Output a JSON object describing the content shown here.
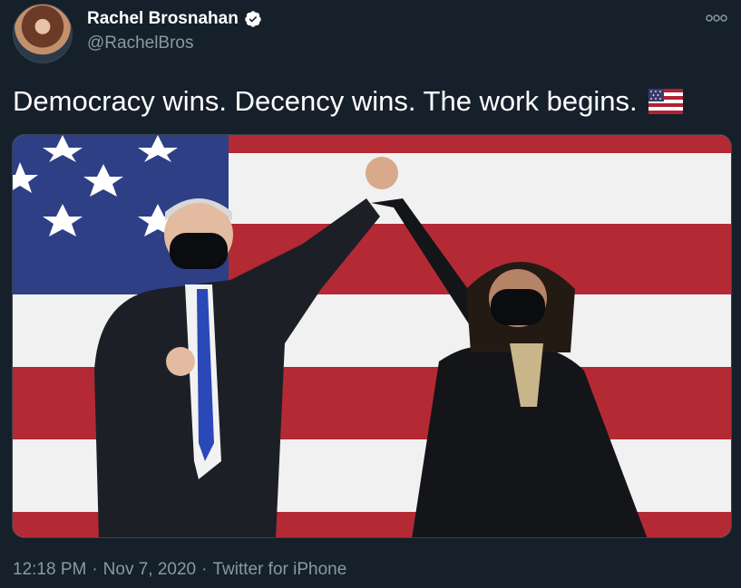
{
  "tweet": {
    "author": {
      "display_name": "Rachel Brosnahan",
      "handle": "@RachelBros",
      "verified": true,
      "avatar_icon": "profile-photo"
    },
    "text": "Democracy wins. Decency wins. The work begins.",
    "emoji": "us-flag-icon",
    "media": {
      "kind": "photo",
      "alt": ""
    },
    "time": "12:18 PM",
    "separator": "·",
    "date": "Nov 7, 2020",
    "source": "Twitter for iPhone"
  },
  "colors": {
    "background": "#15202b",
    "text": "#ffffff",
    "secondary": "#8899a6",
    "verified_badge": "#ffffff",
    "flag_red": "#b22234",
    "flag_blue": "#3c3b6e"
  }
}
